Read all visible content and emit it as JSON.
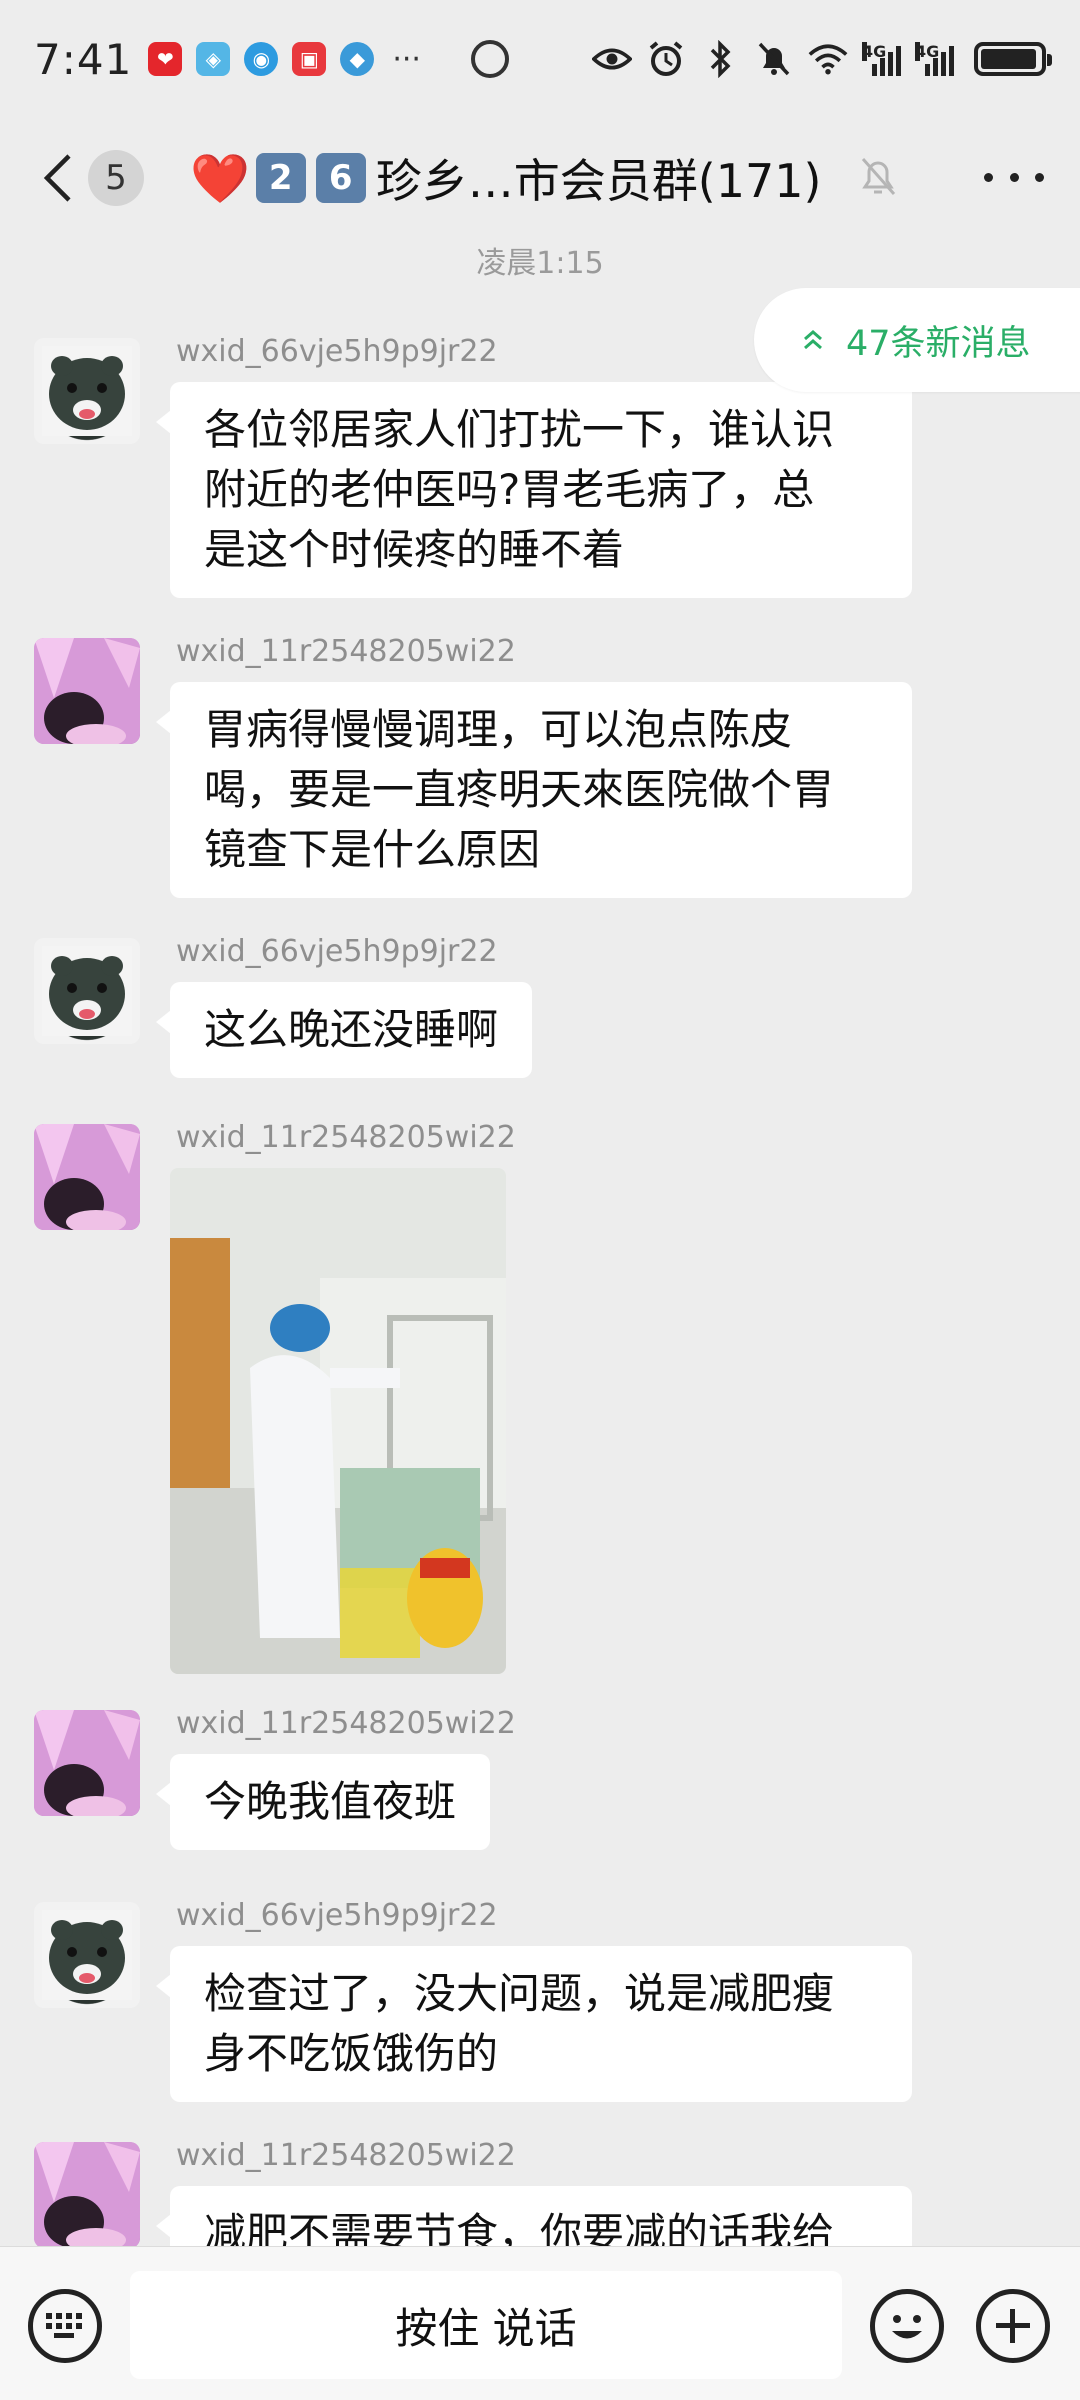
{
  "status_bar": {
    "time": "7:41",
    "more": "···",
    "network_1": "4G",
    "network_2": "4G",
    "battery_percent": 95
  },
  "header": {
    "unread_count": "5",
    "title_heart": "❤️",
    "title_key_1": "2",
    "title_key_2": "6",
    "title_text": "珍乡…市会员群(171)"
  },
  "chat": {
    "timestamp": "凌晨1:15",
    "new_messages": "47条新消息",
    "messages": [
      {
        "sender": "wxid_66vje5h9p9jr22",
        "lines": [
          "各位邻居家人们打扰一下，谁认识",
          "附近的老仲医吗?胃老毛病了，总",
          "是这个时候疼的睡不着"
        ]
      },
      {
        "sender": "wxid_11r2548205wi22",
        "lines": [
          "胃病得慢慢调理，可以泡点陈皮",
          "喝，要是一直疼明天來医院做个胃",
          "镜查下是什么原因"
        ]
      },
      {
        "sender": "wxid_66vje5h9p9jr22",
        "lines": [
          "这么晚还没睡啊"
        ]
      },
      {
        "sender": "wxid_11r2548205wi22",
        "lines": []
      },
      {
        "sender": "wxid_11r2548205wi22",
        "lines": [
          "今晚我值夜班"
        ]
      },
      {
        "sender": "wxid_66vje5h9p9jr22",
        "lines": [
          "检查过了，没大问题，说是减肥瘦",
          "身不吃饭饿伤的"
        ]
      },
      {
        "sender": "wxid_11r2548205wi22",
        "lines": [
          "减肥不需要节食，你要减的话我给"
        ]
      }
    ]
  },
  "input_bar": {
    "hold_to_talk": "按住 说话"
  },
  "colors": {
    "background": "#ededed",
    "bubble": "#ffffff",
    "accent_green": "#2aae67",
    "sender_gray": "#8e8e8e"
  },
  "icons": [
    "back-icon",
    "mute-bell-icon",
    "more-icon",
    "chevron-up-icon",
    "keyboard-icon",
    "emoji-icon",
    "plus-icon"
  ]
}
